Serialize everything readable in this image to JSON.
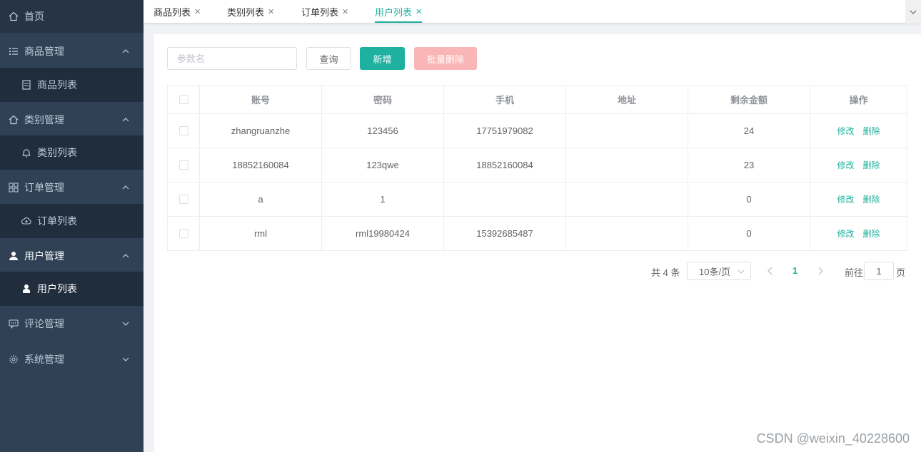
{
  "sidebar": {
    "home": {
      "label": "首页",
      "icon": "home-icon"
    },
    "groups": [
      {
        "label": "商品管理",
        "icon": "list-icon",
        "expanded": true,
        "children": [
          {
            "label": "商品列表",
            "icon": "document-icon"
          }
        ]
      },
      {
        "label": "类别管理",
        "icon": "home-icon",
        "expanded": true,
        "children": [
          {
            "label": "类别列表",
            "icon": "bell-icon"
          }
        ]
      },
      {
        "label": "订单管理",
        "icon": "grid-icon",
        "expanded": true,
        "children": [
          {
            "label": "订单列表",
            "icon": "cloud-icon"
          }
        ]
      },
      {
        "label": "用户管理",
        "icon": "user-icon",
        "expanded": true,
        "active": true,
        "children": [
          {
            "label": "用户列表",
            "icon": "user-icon",
            "active": true
          }
        ]
      },
      {
        "label": "评论管理",
        "icon": "chat-icon",
        "expanded": false,
        "children": []
      },
      {
        "label": "系统管理",
        "icon": "gear-icon",
        "expanded": false,
        "children": []
      }
    ]
  },
  "tabs": [
    {
      "label": "商品列表",
      "active": false
    },
    {
      "label": "类别列表",
      "active": false
    },
    {
      "label": "订单列表",
      "active": false
    },
    {
      "label": "用户列表",
      "active": true
    }
  ],
  "toolbar": {
    "search_placeholder": "参数名",
    "query_label": "查询",
    "add_label": "新增",
    "batch_delete_label": "批量删除"
  },
  "table": {
    "columns": [
      "账号",
      "密码",
      "手机",
      "地址",
      "剩余金额",
      "操作"
    ],
    "rows": [
      {
        "account": "zhangruanzhe",
        "password": "123456",
        "phone": "17751979082",
        "address": "",
        "balance": "24"
      },
      {
        "account": "18852160084",
        "password": "123qwe",
        "phone": "18852160084",
        "address": "",
        "balance": "23"
      },
      {
        "account": "a",
        "password": "1",
        "phone": "",
        "address": "",
        "balance": "0"
      },
      {
        "account": "rml",
        "password": "rml19980424",
        "phone": "15392685487",
        "address": "",
        "balance": "0"
      }
    ],
    "edit_label": "修改",
    "delete_label": "删除"
  },
  "pagination": {
    "total_text": "共 4 条",
    "page_size": "10条/页",
    "current_page": "1",
    "goto_prefix": "前往",
    "goto_value": "1",
    "goto_suffix": "页"
  },
  "watermark": "CSDN @weixin_40228600",
  "colors": {
    "accent": "#1fb19f",
    "sidebar_bg": "#304156",
    "danger_disabled": "#fab6b6"
  }
}
